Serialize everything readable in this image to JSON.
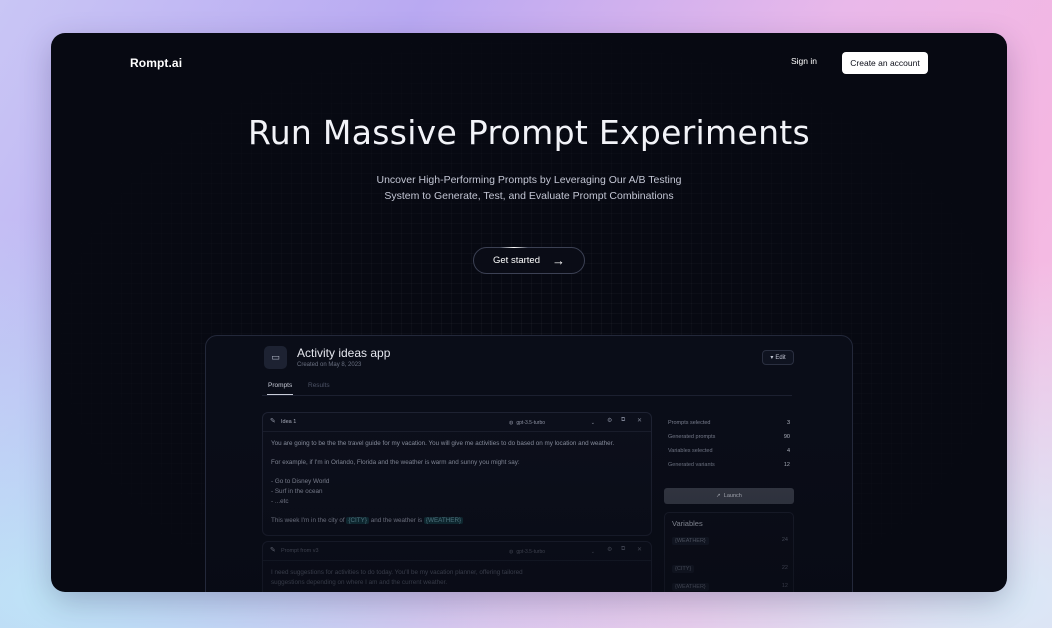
{
  "nav": {
    "logo": "Rompt.ai",
    "signin": "Sign in",
    "create_account": "Create an account"
  },
  "hero": {
    "title": "Run Massive Prompt Experiments",
    "subtitle_line1": "Uncover High-Performing Prompts by Leveraging Our A/B Testing",
    "subtitle_line2": "System to Generate, Test, and Evaluate Prompt Combinations",
    "cta": "Get started",
    "cta_icon": "arrow-right-icon"
  },
  "preview": {
    "title": "Activity ideas app",
    "created": "Created on May 8, 2023",
    "edit": "Edit",
    "tabs": [
      "Prompts",
      "Results"
    ],
    "card1": {
      "name": "Idea 1",
      "model": "gpt-3.5-turbo",
      "line1": "You are going to be the the travel guide for my vacation. You will give me activities to do based on my location and weather.",
      "line2": "For example, if I'm in Orlando, Florida and the weather is warm and sunny you might say:",
      "list1": "- Go to Disney World",
      "list2": "- Surf in the ocean",
      "list3": "- ...etc",
      "line3_pre": "This week I'm in the city of ",
      "var_city": "{CITY}",
      "line3_mid": " and the weather is ",
      "var_weather": "{WEATHER}"
    },
    "card2": {
      "name": "Prompt from v3",
      "model": "gpt-3.5-turbo",
      "line1": "I need suggestions for activities to do today. You'll be my vacation planner, offering tailored",
      "line2": "suggestions depending on where I am and the current weather."
    },
    "stats": [
      {
        "label": "Prompts selected",
        "value": "3"
      },
      {
        "label": "Generated prompts",
        "value": "90"
      },
      {
        "label": "Variables selected",
        "value": "4"
      },
      {
        "label": "Generated variants",
        "value": "12"
      }
    ],
    "launch": "Launch",
    "variables": {
      "title": "Variables",
      "rows": [
        {
          "name": "{WEATHER}",
          "value": "24"
        },
        {
          "name": "{CITY}",
          "value": "22"
        },
        {
          "name": "{WEATHER}",
          "value": "12"
        }
      ]
    }
  }
}
